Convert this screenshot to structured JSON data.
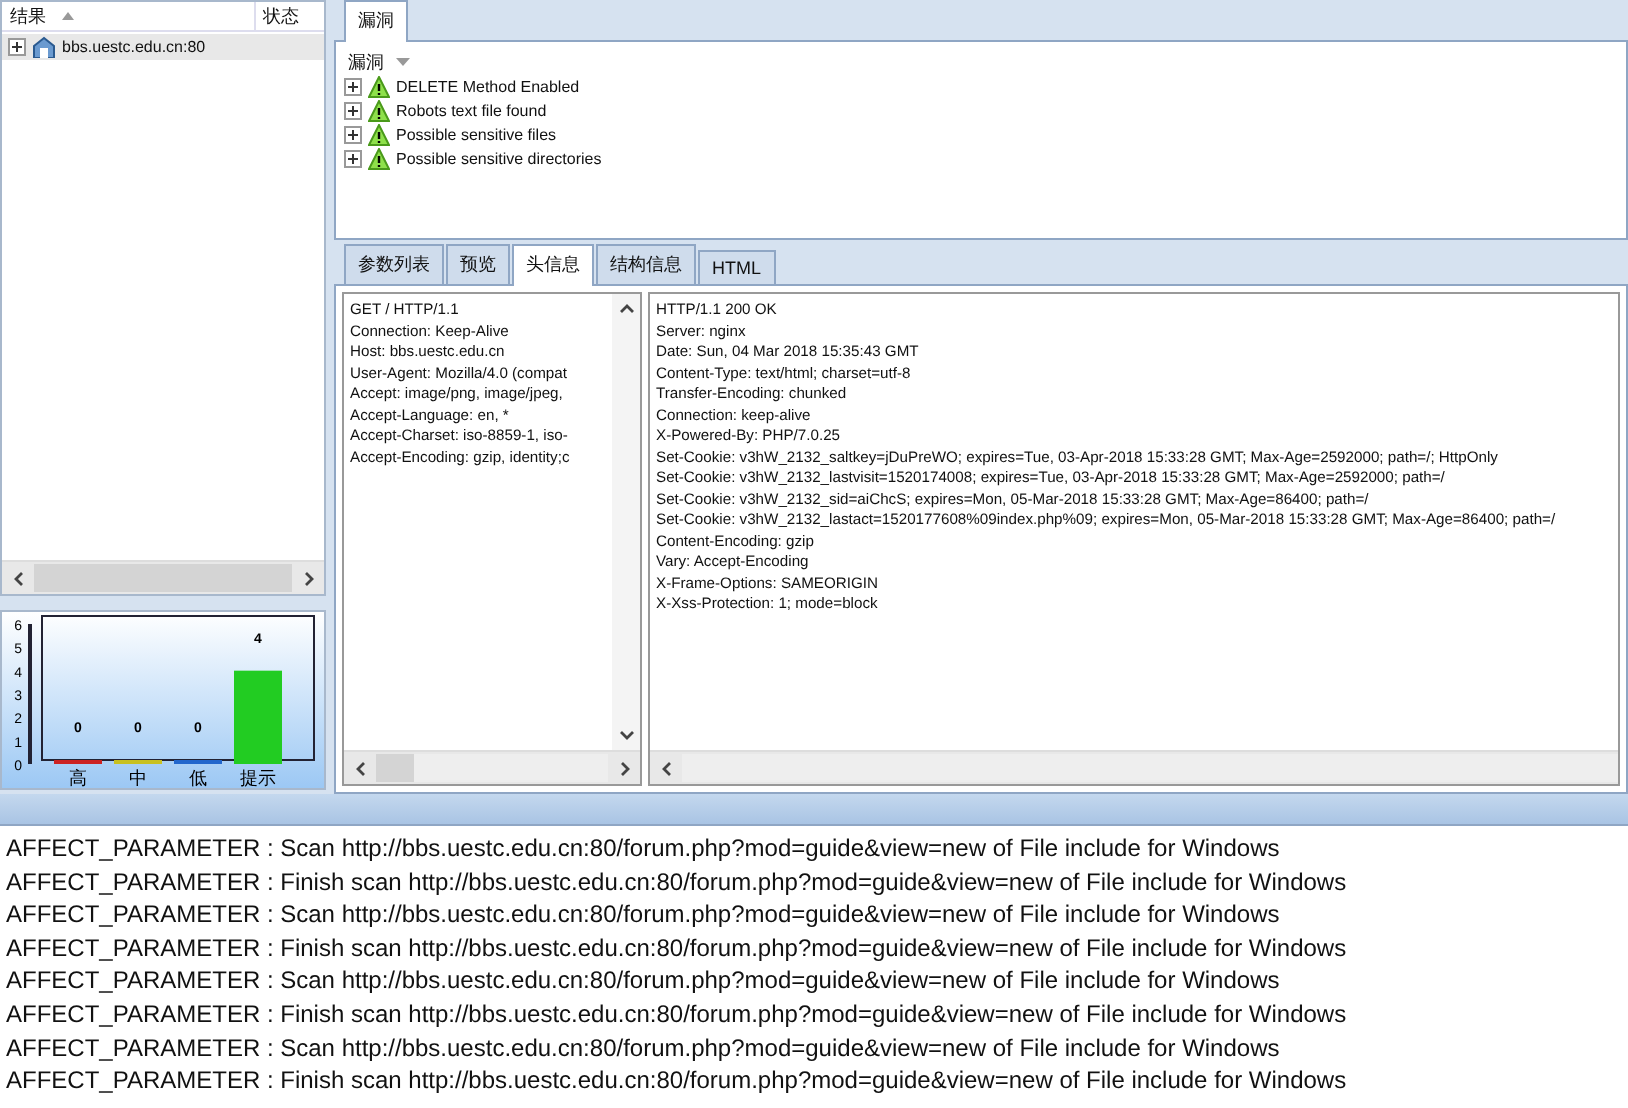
{
  "results_tree": {
    "columns": [
      {
        "label": "结果",
        "sorted": true
      },
      {
        "label": "状态",
        "sorted": false
      }
    ],
    "items": [
      {
        "label": "bbs.uestc.edu.cn:80",
        "expanded": false,
        "selected": true
      }
    ]
  },
  "severity_chart": {
    "chart_data": {
      "type": "bar",
      "categories": [
        "高",
        "中",
        "低",
        "提示"
      ],
      "colors": [
        "#cc2222",
        "#c8c020",
        "#2266cc",
        "#22cc22"
      ],
      "series": [
        {
          "values": [
            0,
            0,
            0,
            4
          ]
        }
      ],
      "ylim": [
        0,
        6
      ],
      "yticks": [
        0,
        1,
        2,
        3,
        4,
        5,
        6
      ],
      "data_labels": true
    }
  },
  "vuln_panel": {
    "tab": {
      "label": "漏洞",
      "selected": true
    },
    "header": "漏洞",
    "items": [
      {
        "label": "DELETE Method Enabled",
        "expanded": false
      },
      {
        "label": "Robots text file found",
        "expanded": false
      },
      {
        "label": "Possible sensitive files",
        "expanded": false
      },
      {
        "label": "Possible sensitive directories",
        "expanded": false
      }
    ]
  },
  "detail_tabs": [
    {
      "label": "参数列表",
      "selected": false
    },
    {
      "label": "预览",
      "selected": false
    },
    {
      "label": "头信息",
      "selected": true
    },
    {
      "label": "结构信息",
      "selected": false
    },
    {
      "label": "HTML",
      "selected": false
    }
  ],
  "request_headers": [
    "GET / HTTP/1.1",
    "Connection: Keep-Alive",
    "Host: bbs.uestc.edu.cn",
    "User-Agent: Mozilla/4.0 (compat",
    "Accept: image/png, image/jpeg,",
    "Accept-Language: en, *",
    "Accept-Charset: iso-8859-1, iso-",
    "Accept-Encoding: gzip, identity;c"
  ],
  "response_headers": [
    "HTTP/1.1 200 OK",
    "Server: nginx",
    "Date: Sun, 04 Mar 2018 15:35:43 GMT",
    "Content-Type: text/html; charset=utf-8",
    "Transfer-Encoding: chunked",
    "Connection: keep-alive",
    "X-Powered-By: PHP/7.0.25",
    "Set-Cookie: v3hW_2132_saltkey=jDuPreWO; expires=Tue, 03-Apr-2018 15:33:28 GMT; Max-Age=2592000; path=/; HttpOnly",
    "Set-Cookie: v3hW_2132_lastvisit=1520174008; expires=Tue, 03-Apr-2018 15:33:28 GMT; Max-Age=2592000; path=/",
    "Set-Cookie: v3hW_2132_sid=aiChcS; expires=Mon, 05-Mar-2018 15:33:28 GMT; Max-Age=86400; path=/",
    "Set-Cookie: v3hW_2132_lastact=1520177608%09index.php%09; expires=Mon, 05-Mar-2018 15:33:28 GMT; Max-Age=86400; path=/",
    "Content-Encoding: gzip",
    "Vary: Accept-Encoding",
    "X-Frame-Options: SAMEORIGIN",
    "X-Xss-Protection: 1; mode=block"
  ],
  "log": [
    "AFFECT_PARAMETER : Scan http://bbs.uestc.edu.cn:80/forum.php?mod=guide&view=new of File include for Windows",
    "AFFECT_PARAMETER : Finish scan http://bbs.uestc.edu.cn:80/forum.php?mod=guide&view=new of File include for Windows",
    "AFFECT_PARAMETER : Scan http://bbs.uestc.edu.cn:80/forum.php?mod=guide&view=new of File include for Windows",
    "AFFECT_PARAMETER : Finish scan http://bbs.uestc.edu.cn:80/forum.php?mod=guide&view=new of File include for Windows",
    "AFFECT_PARAMETER : Scan http://bbs.uestc.edu.cn:80/forum.php?mod=guide&view=new of File include for Windows",
    "AFFECT_PARAMETER : Finish scan http://bbs.uestc.edu.cn:80/forum.php?mod=guide&view=new of File include for Windows",
    "AFFECT_PARAMETER : Scan http://bbs.uestc.edu.cn:80/forum.php?mod=guide&view=new of File include for Windows",
    "AFFECT_PARAMETER : Finish scan http://bbs.uestc.edu.cn:80/forum.php?mod=guide&view=new of File include for Windows"
  ]
}
